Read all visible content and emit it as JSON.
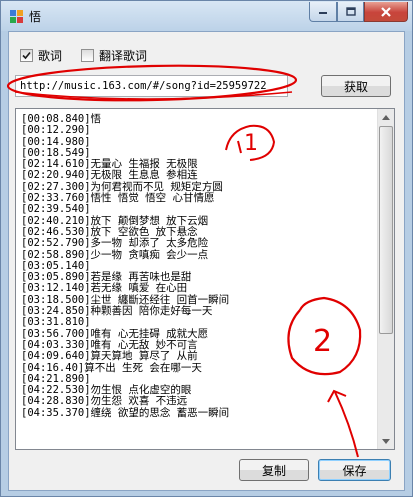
{
  "window": {
    "title": "悟",
    "controls": [
      "minimize-icon",
      "maximize-icon",
      "close-icon"
    ]
  },
  "options": {
    "lyrics_checkbox_label": "歌词",
    "lyrics_checked": true,
    "translate_checkbox_label": "翻译歌词",
    "translate_checked": false
  },
  "url_input": {
    "value": "http://music.163.com/#/song?id=25959722"
  },
  "buttons": {
    "fetch": "获取",
    "copy": "复制",
    "save": "保存"
  },
  "lyrics_text": "[00:08.840]悟\n[00:12.290]\n[00:14.980]\n[00:18.549]\n[02:14.610]无量心 生福报 无极限\n[02:20.940]无极限 生息息 参相连\n[02:27.300]为何君视而不见 规矩定方圆\n[02:33.760]悟性 悟觉 悟空 心甘情愿\n[02:39.540]\n[02:40.210]放下 颠倒梦想 放下云烟\n[02:46.530]放下 空欲色 放下悬念\n[02:52.790]多一物 却添了 太多危险\n[02:58.890]少一物 贪嗔痴 会少一点\n[03:05.140]\n[03:05.890]若是缘 再苦味也是甜\n[03:12.140]若无缘 嗔爱 在心田\n[03:18.500]尘世 纏斷还经往 回首一瞬间\n[03:24.850]种颗善因 陪你走好每一天\n[03:31.810]\n[03:56.700]唯有 心无挂碍 成就大愿\n[04:03.330]唯有 心无敌 妙不可言\n[04:09.640]算天算地 算尽了 从前\n[04:16.40]算不出 生死 会在哪一天\n[04:21.890]\n[04:22.530]勿生恨 点化虚空的眼\n[04:28.830]勿生怨 欢喜 不违远\n[04:35.370]缠绕 欲望的思念 蓄恶一瞬间",
  "annotations": {
    "mark_1": "1",
    "mark_2": "2",
    "color": "#e00000"
  }
}
